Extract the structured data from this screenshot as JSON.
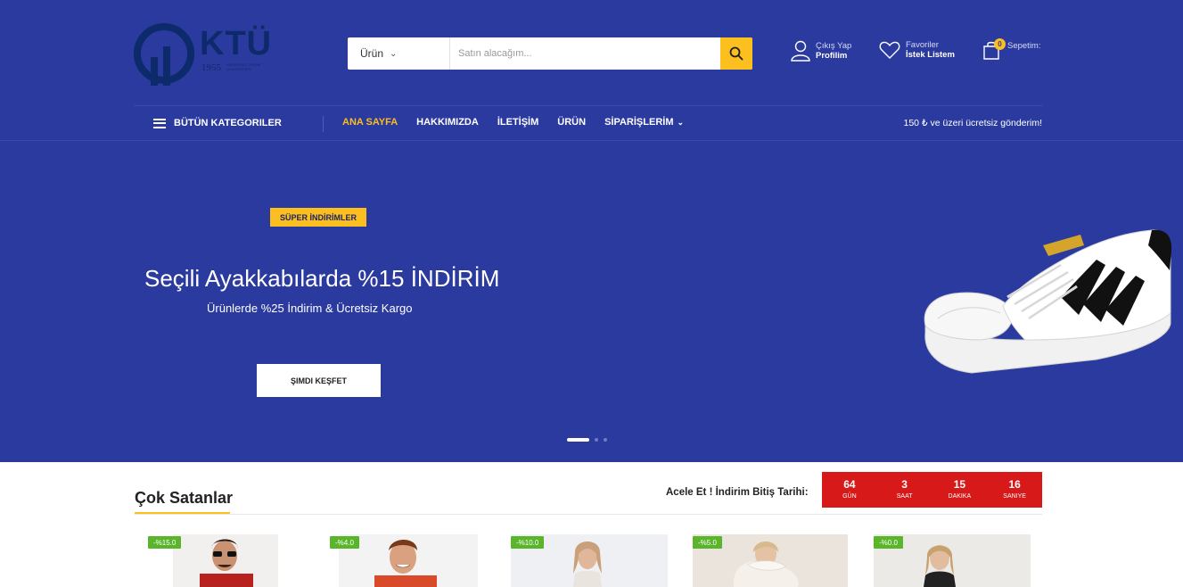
{
  "brand": {
    "logo_text": "KTÜ",
    "logo_year": "1955",
    "logo_subtitle": "Karadeniz Teknik Üniversitesi"
  },
  "search": {
    "category": "Ürün",
    "placeholder": "Satın alacağım..."
  },
  "header": {
    "account": {
      "line1": "Çıkış Yap",
      "line2": "Profilim"
    },
    "favorites": {
      "line1": "Favoriler",
      "line2": "İstek Listem"
    },
    "cart": {
      "count": "0",
      "label": "Sepetim:"
    }
  },
  "nav": {
    "all_categories": "BÜTÜN KATEGORILER",
    "items": [
      {
        "label": "ANA SAYFA",
        "active": true
      },
      {
        "label": "HAKKIMIZDA"
      },
      {
        "label": "İLETİŞİM"
      },
      {
        "label": "ÜRÜN"
      },
      {
        "label": "SİPARİŞLERİM"
      }
    ],
    "free_shipping": "150 ₺ ve üzeri ücretsiz gönderim!"
  },
  "hero": {
    "badge": "SÜPER İNDİRİMLER",
    "title": "Seçili Ayakkabılarda %15 İNDİRİM",
    "subtitle": "Ürünlerde %25 İndirim & Ücretsiz Kargo",
    "cta": "ŞIMDI KEŞFET",
    "slides": 3,
    "active_slide": 1
  },
  "best_sellers": {
    "title": "Çok Satanlar",
    "deal_label": "Acele Et ! İndirim Bitiş Tarihi:",
    "countdown": [
      {
        "value": "64",
        "label": "GÜN"
      },
      {
        "value": "3",
        "label": "SAAT"
      },
      {
        "value": "15",
        "label": "DAKIKA"
      },
      {
        "value": "16",
        "label": "SANIYE"
      }
    ],
    "products": [
      {
        "discount": "-%15.0"
      },
      {
        "discount": "-%4.0"
      },
      {
        "discount": "-%10.0"
      },
      {
        "discount": "-%5.0"
      },
      {
        "discount": "-%0.0"
      }
    ]
  },
  "colors": {
    "primary": "#2b3a9e",
    "accent": "#fbbf1f",
    "countdown": "#d7191a",
    "discount": "#5ab52b"
  }
}
